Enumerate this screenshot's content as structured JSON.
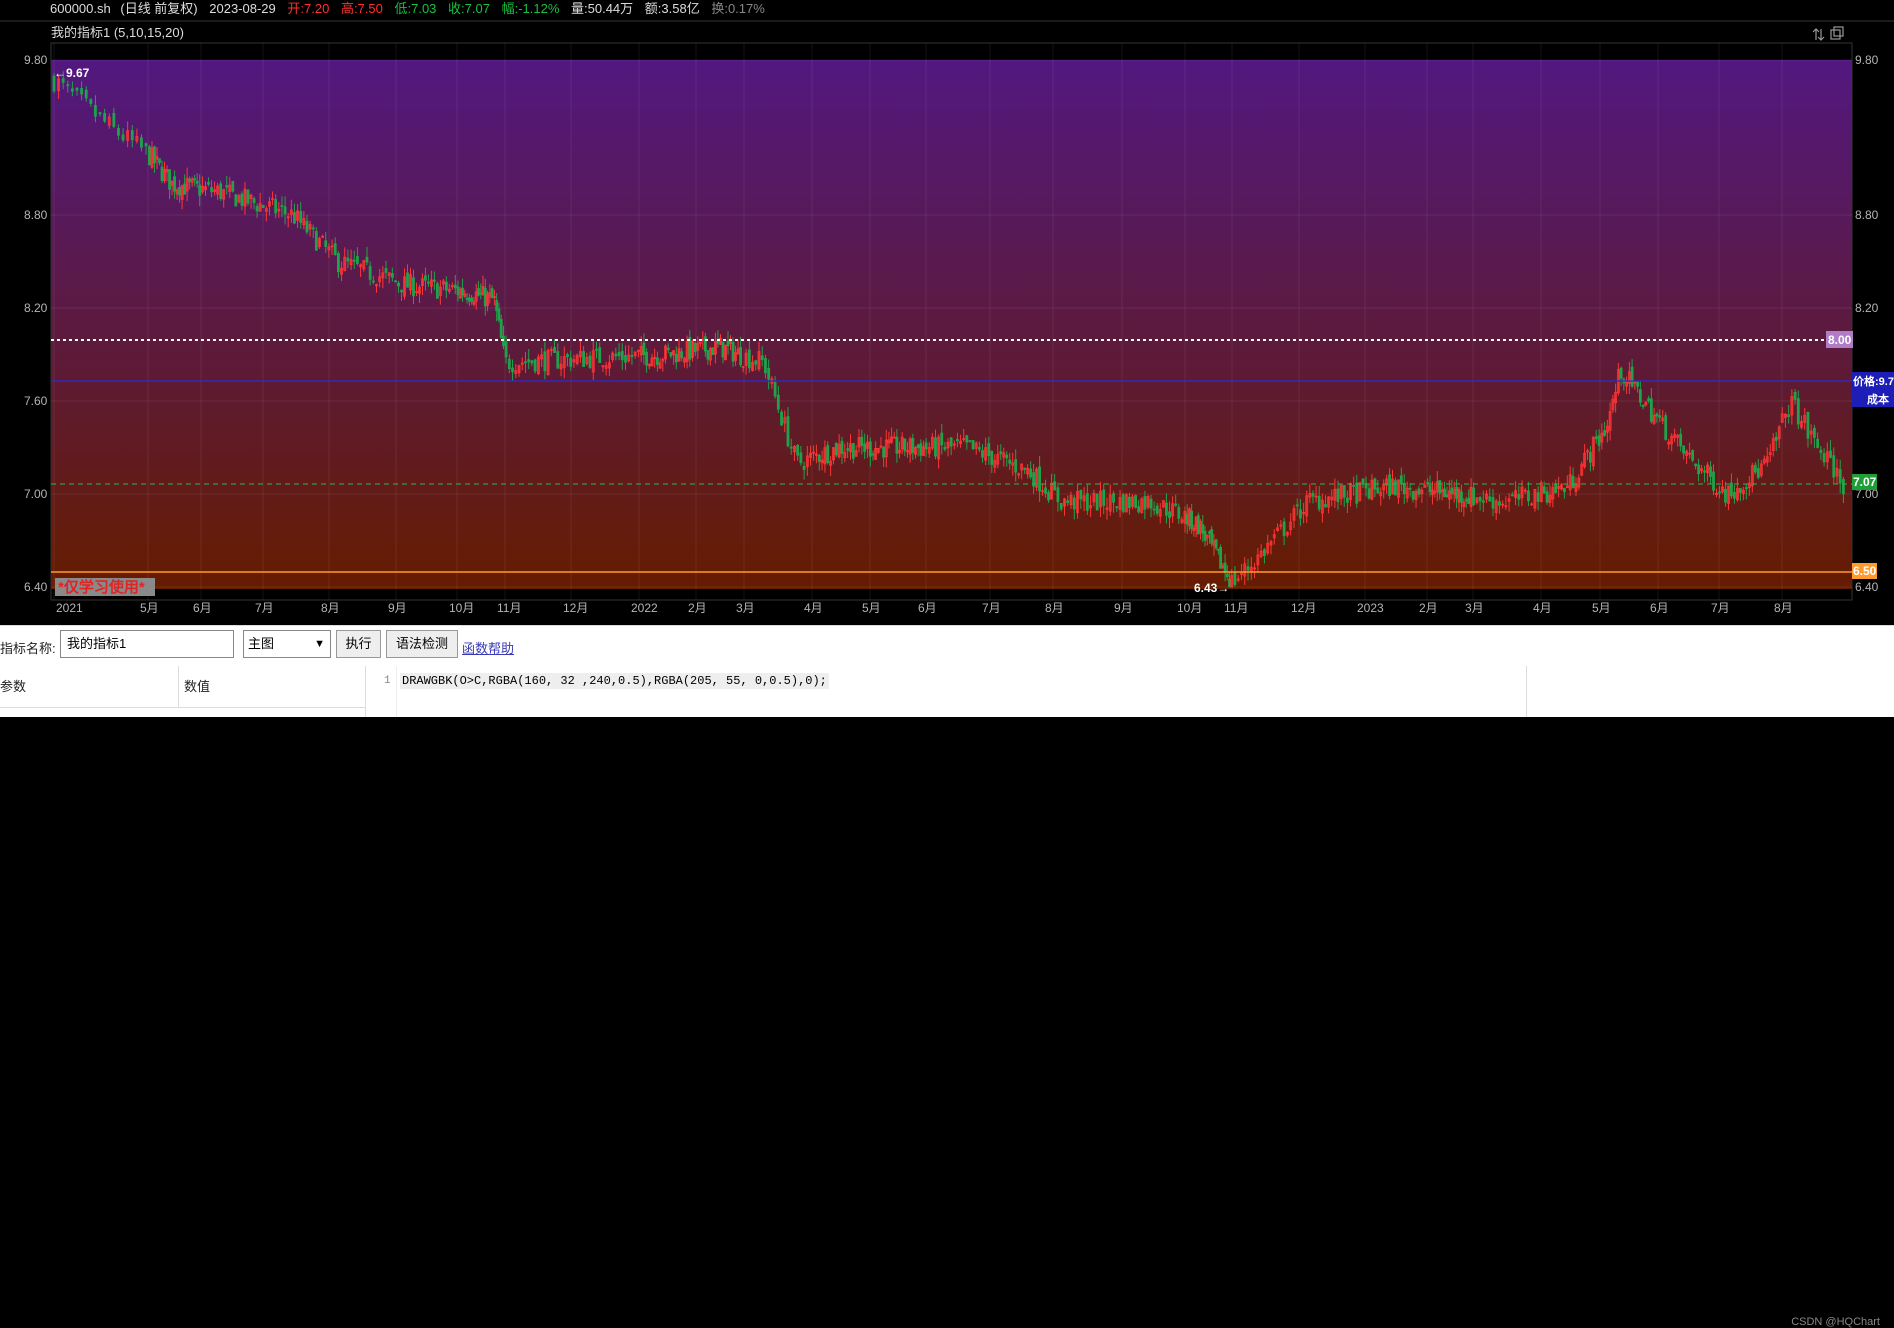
{
  "header": {
    "symbol": "600000.sh",
    "period": "(日线 前复权)",
    "date": "2023-08-29",
    "open": "开:7.20",
    "high": "高:7.50",
    "low": "低:7.03",
    "close": "收:7.07",
    "change": "幅:-1.12%",
    "volume": "量:50.44万",
    "amount": "额:3.58亿",
    "turnover": "换:0.17%"
  },
  "indicator_title": "我的指标1 (5,10,15,20)",
  "watermark_study": "*仅学习使用*",
  "colors": {
    "up": "#ff3535",
    "down": "#1fa34a",
    "bg_top": "rgba(160,32,240,0.5)",
    "bg_bottom": "rgba(205,55,0,0.5)"
  },
  "overlays": {
    "high_label": "←9.67",
    "low_label": "6.43→",
    "dotted_line_label": "8.00",
    "cost_line_label_1": "价格:9.7",
    "cost_line_label_2": "成本",
    "close_label": "7.07",
    "orange_line_label": "6.50"
  },
  "chart_data": {
    "type": "candlestick",
    "title": "我的指标1 (5,10,15,20)",
    "ylim": [
      6.4,
      9.8
    ],
    "y_ticks": [
      "9.80",
      "8.80",
      "8.20",
      "7.60",
      "7.00",
      "6.40"
    ],
    "x_ticks": [
      "2021",
      "5月",
      "6月",
      "7月",
      "8月",
      "9月",
      "10月",
      "11月",
      "12月",
      "2022",
      "2月",
      "3月",
      "4月",
      "5月",
      "6月",
      "7月",
      "8月",
      "9月",
      "10月",
      "11月",
      "12月",
      "2023",
      "2月",
      "3月",
      "4月",
      "5月",
      "6月",
      "7月",
      "8月"
    ],
    "series_path": {
      "dates": [
        "2021-04-01",
        "2021-04-20",
        "2021-05-15",
        "2021-06-10",
        "2021-07-15",
        "2021-08-05",
        "2021-09-05",
        "2021-10-10",
        "2021-10-25",
        "2021-11-01",
        "2021-12-15",
        "2022-01-15",
        "2022-02-15",
        "2022-03-10",
        "2022-03-25",
        "2022-04-15",
        "2022-05-20",
        "2022-06-20",
        "2022-07-20",
        "2022-08-05",
        "2022-09-15",
        "2022-10-10",
        "2022-11-01",
        "2022-11-10",
        "2022-12-05",
        "2023-01-15",
        "2023-02-20",
        "2023-03-15",
        "2023-04-15",
        "2023-05-05",
        "2023-05-12",
        "2023-06-15",
        "2023-07-05",
        "2023-07-25",
        "2023-08-05",
        "2023-08-15",
        "2023-08-29"
      ],
      "prices": [
        9.67,
        9.35,
        9.0,
        8.95,
        8.8,
        8.5,
        8.35,
        8.3,
        8.25,
        7.85,
        7.88,
        7.9,
        7.95,
        7.85,
        7.2,
        7.3,
        7.3,
        7.3,
        7.15,
        6.95,
        6.95,
        6.8,
        6.43,
        6.55,
        6.95,
        7.05,
        7.0,
        6.95,
        7.05,
        7.45,
        7.8,
        7.25,
        7.0,
        7.2,
        7.6,
        7.35,
        7.07
      ]
    },
    "reference_lines": {
      "dotted_white": 8.0,
      "blue_solid": 7.7,
      "green_dashed": 7.07,
      "orange_solid": 6.5
    },
    "candle_count": 600
  },
  "editor": {
    "name_label": "指标名称:",
    "name_value": "我的指标1",
    "select_value": "主图",
    "run_button": "执行",
    "check_button": "语法检测",
    "help_link": "函数帮助",
    "param_col": "参数",
    "value_col": "数值",
    "line_no": "1",
    "code": "DRAWGBK(O>C,RGBA(160, 32 ,240,0.5),RGBA(205, 55, 0,0.5),0);"
  },
  "credit": "CSDN @HQChart"
}
